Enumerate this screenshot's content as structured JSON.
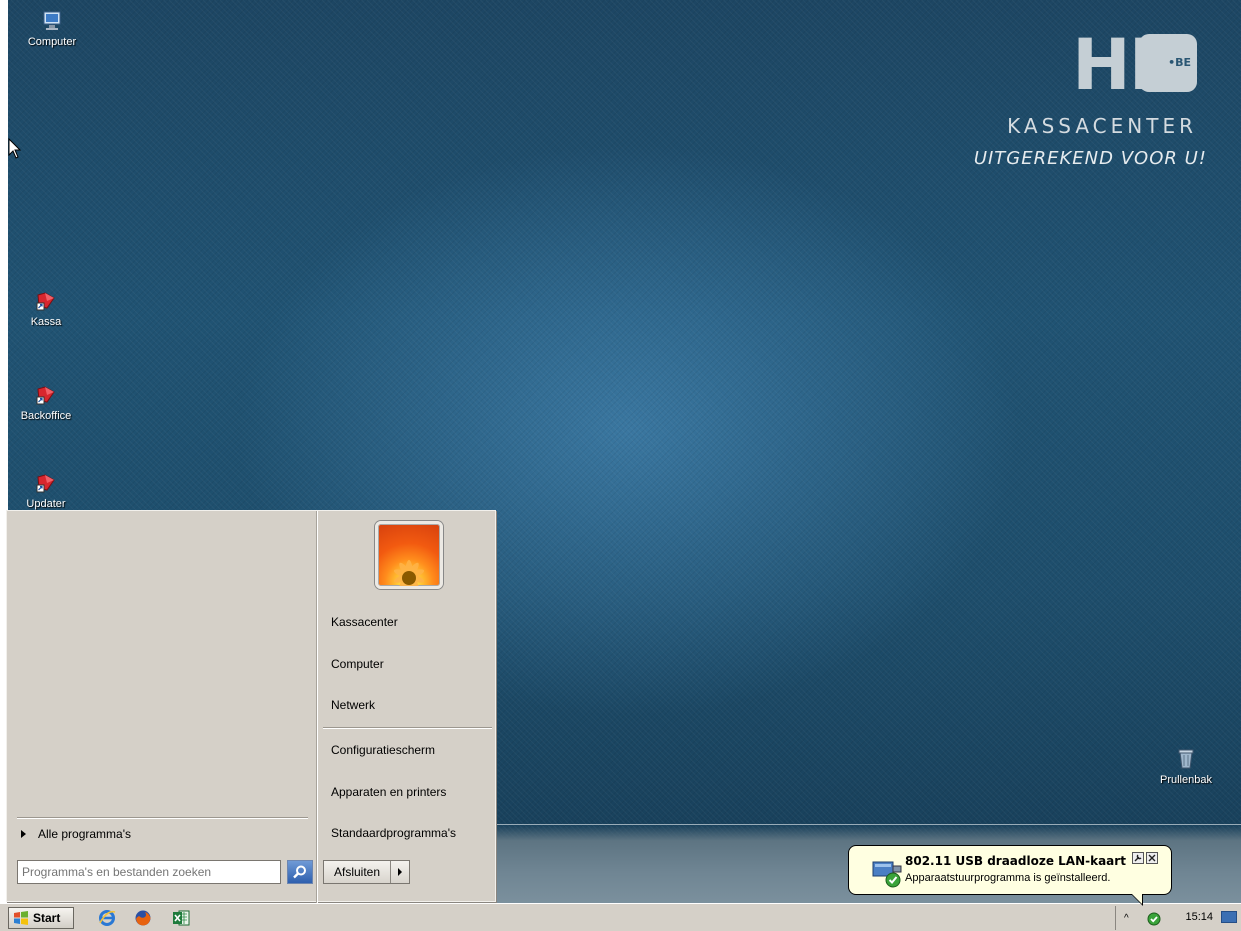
{
  "desktop": {
    "icons": [
      {
        "label": "Computer"
      },
      {
        "label": "Kassa"
      },
      {
        "label": "Backoffice"
      },
      {
        "label": "Updater"
      },
      {
        "label": "Prullenbak"
      }
    ],
    "brand": {
      "logo_text": "HK",
      "logo_badge": "•BE",
      "name": "KASSACENTER",
      "slogan": "UITGEREKEND VOOR U!"
    }
  },
  "start_menu": {
    "all_programs": "Alle programma's",
    "search_placeholder": "Programma's en bestanden zoeken",
    "right_links": [
      {
        "label": "Kassacenter"
      },
      {
        "label": "Computer"
      },
      {
        "label": "Netwerk"
      },
      {
        "label": "Configuratiescherm"
      },
      {
        "label": "Apparaten en printers"
      },
      {
        "label": "Standaardprogramma's"
      }
    ],
    "shutdown_label": "Afsluiten"
  },
  "taskbar": {
    "start_label": "Start",
    "quick_launch": [
      "ie-icon",
      "firefox-icon",
      "excel-icon"
    ],
    "clock": "15:14",
    "tray_chevron": "^"
  },
  "notification": {
    "title": "802.11 USB draadloze LAN-kaart",
    "text": "Apparaatstuurprogramma is geïnstalleerd."
  }
}
